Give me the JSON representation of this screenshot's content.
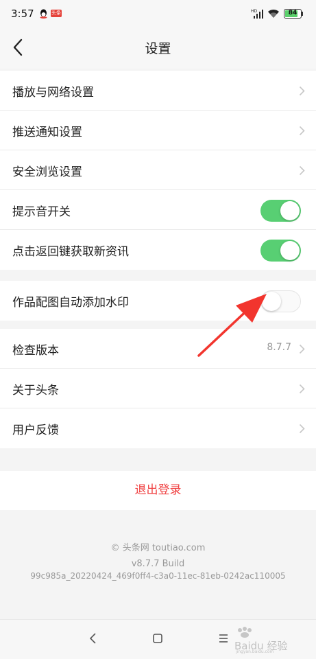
{
  "status_bar": {
    "time": "3:57",
    "notification_badge": "头条",
    "network_label": "HD",
    "battery_level": "84",
    "battery_fraction": 0.84
  },
  "header": {
    "title": "设置",
    "back_icon": "chevron-left-icon"
  },
  "settings_group_1": [
    {
      "label": "播放与网络设置",
      "control": "chevron"
    },
    {
      "label": "推送通知设置",
      "control": "chevron"
    },
    {
      "label": "安全浏览设置",
      "control": "chevron"
    },
    {
      "label": "提示音开关",
      "control": "toggle",
      "on": true
    },
    {
      "label": "点击返回键获取新资讯",
      "control": "toggle",
      "on": true
    }
  ],
  "settings_group_2": [
    {
      "label": "作品配图自动添加水印",
      "control": "toggle",
      "on": false
    }
  ],
  "settings_group_3": [
    {
      "label": "检查版本",
      "value": "8.7.7",
      "control": "chevron"
    },
    {
      "label": "关于头条",
      "control": "chevron"
    },
    {
      "label": "用户反馈",
      "control": "chevron"
    }
  ],
  "logout_label": "退出登录",
  "footer": {
    "copyright": "© 头条网 toutiao.com",
    "version": "v8.7.7 Build",
    "build_id": "99c985a_20220424_469f0ff4-c3a0-11ec-81eb-0242ac110005"
  },
  "watermark": {
    "text": "Baidu 经验",
    "url": "jingyan.baidu.com"
  },
  "colors": {
    "toggle_on": "#58cf73",
    "logout_red": "#f04142",
    "annotation_arrow": "#f2352e"
  }
}
